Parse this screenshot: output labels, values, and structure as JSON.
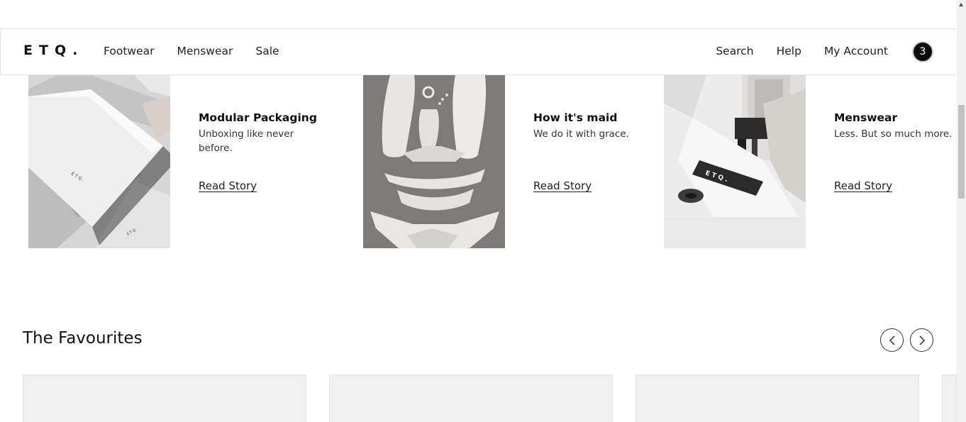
{
  "header": {
    "logo": "ETQ.",
    "nav_left": [
      "Footwear",
      "Menswear",
      "Sale"
    ],
    "nav_right": [
      "Search",
      "Help",
      "My Account"
    ],
    "cart_count": "3"
  },
  "stories": [
    {
      "title": "Modular Packaging",
      "desc": "Unboxing like never before.",
      "link": "Read Story"
    },
    {
      "title": "How it's maid",
      "desc": "We do it with grace.",
      "link": "Read Story"
    },
    {
      "title": "Menswear",
      "desc": "Less. But so much more.",
      "link": "Read Story"
    }
  ],
  "favourites": {
    "title": "The Favourites",
    "prev_icon": "chevron-left-icon",
    "next_icon": "chevron-right-icon"
  }
}
